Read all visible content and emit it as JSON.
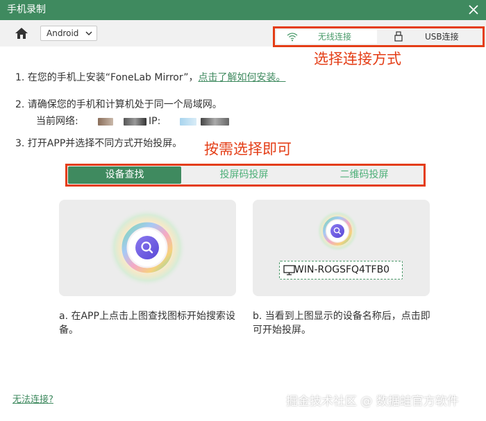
{
  "window": {
    "title": "手机录制",
    "close_icon": "close-icon"
  },
  "toolbar": {
    "home_icon": "home-icon",
    "os_select": {
      "value": "Android",
      "icon": "chevron-down-icon"
    },
    "connection_tabs": [
      {
        "label": "无线连接",
        "icon": "wifi-icon",
        "selected": true
      },
      {
        "label": "USB连接",
        "icon": "usb-icon",
        "selected": false
      }
    ]
  },
  "annotations": {
    "connection": "选择连接方式",
    "method": "按需选择即可"
  },
  "steps": {
    "step1_text": "1. 在您的手机上安装“FoneLab Mirror”，",
    "step1_link": "点击了解如何安装。",
    "step2_text": "2. 请确保您的手机和计算机处于同一个局域网。",
    "network_label": "当前网络:",
    "ip_label": "IP:",
    "step3_text": "3. 打开APP并选择不同方式开始投屏。"
  },
  "methods": [
    {
      "label": "设备查找",
      "selected": true
    },
    {
      "label": "投屏码投屏",
      "selected": false
    },
    {
      "label": "二维码投屏",
      "selected": false
    }
  ],
  "cards": {
    "left_icon": "search-icon",
    "right_device": {
      "icon": "monitor-icon",
      "name": "WIN-ROGSFQ4TFB0"
    },
    "left_desc": "a. 在APP上点击上图查找图标开始搜索设备。",
    "right_desc": "b. 当看到上图显示的设备名称后，点击即可开始投屏。"
  },
  "help_link": "无法连接?",
  "watermark": "掘金技术社区 @ 数据蛙官方软件",
  "colors": {
    "brand_green": "#3f8a5f",
    "annotation_red": "#e43d16"
  }
}
